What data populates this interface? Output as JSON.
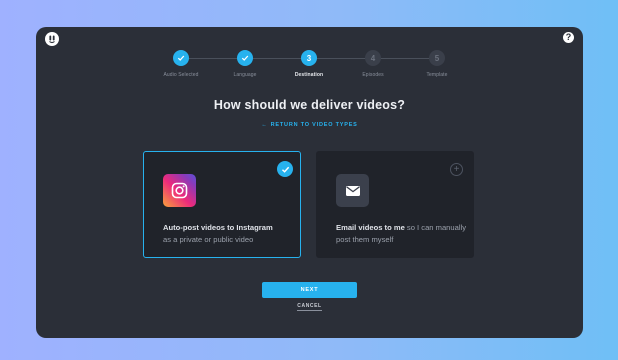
{
  "header": {
    "help_label": "?"
  },
  "stepper": {
    "steps": [
      {
        "label": "Audio Selected",
        "state": "done",
        "number": ""
      },
      {
        "label": "Language",
        "state": "done",
        "number": ""
      },
      {
        "label": "Destination",
        "state": "active",
        "number": "3"
      },
      {
        "label": "Episodes",
        "state": "todo",
        "number": "4"
      },
      {
        "label": "Template",
        "state": "todo",
        "number": "5"
      }
    ]
  },
  "main": {
    "title": "How should we deliver videos?",
    "back_link": "RETURN TO VIDEO TYPES",
    "back_arrow": "←",
    "options": [
      {
        "bold": "Auto-post videos to Instagram",
        "rest": "as a private or public video",
        "selected": true,
        "icon": "instagram-icon"
      },
      {
        "bold": "Email videos to me",
        "rest": "so I can manually post them myself",
        "selected": false,
        "icon": "envelope-icon"
      }
    ]
  },
  "footer": {
    "next_label": "NEXT",
    "cancel_label": "CANCEL"
  },
  "colors": {
    "accent": "#27b2ee",
    "modal_bg": "#2b2f38",
    "card_bg": "#20232a"
  }
}
